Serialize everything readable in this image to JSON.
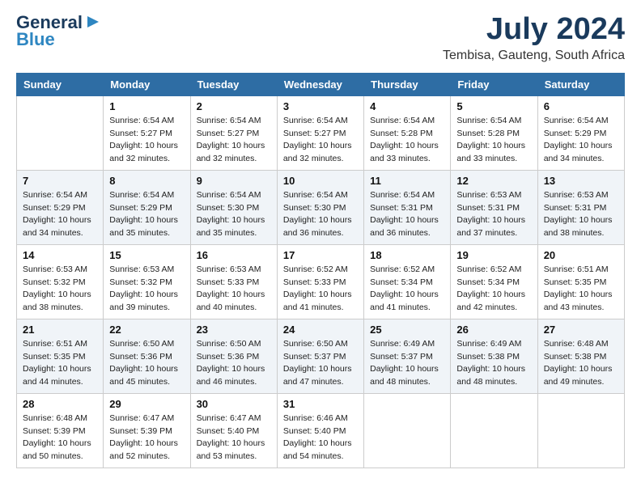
{
  "logo": {
    "line1": "General",
    "line2": "Blue"
  },
  "header": {
    "month": "July 2024",
    "location": "Tembisa, Gauteng, South Africa"
  },
  "weekdays": [
    "Sunday",
    "Monday",
    "Tuesday",
    "Wednesday",
    "Thursday",
    "Friday",
    "Saturday"
  ],
  "weeks": [
    [
      {
        "day": "",
        "info": ""
      },
      {
        "day": "1",
        "info": "Sunrise: 6:54 AM\nSunset: 5:27 PM\nDaylight: 10 hours\nand 32 minutes."
      },
      {
        "day": "2",
        "info": "Sunrise: 6:54 AM\nSunset: 5:27 PM\nDaylight: 10 hours\nand 32 minutes."
      },
      {
        "day": "3",
        "info": "Sunrise: 6:54 AM\nSunset: 5:27 PM\nDaylight: 10 hours\nand 32 minutes."
      },
      {
        "day": "4",
        "info": "Sunrise: 6:54 AM\nSunset: 5:28 PM\nDaylight: 10 hours\nand 33 minutes."
      },
      {
        "day": "5",
        "info": "Sunrise: 6:54 AM\nSunset: 5:28 PM\nDaylight: 10 hours\nand 33 minutes."
      },
      {
        "day": "6",
        "info": "Sunrise: 6:54 AM\nSunset: 5:29 PM\nDaylight: 10 hours\nand 34 minutes."
      }
    ],
    [
      {
        "day": "7",
        "info": "Sunrise: 6:54 AM\nSunset: 5:29 PM\nDaylight: 10 hours\nand 34 minutes."
      },
      {
        "day": "8",
        "info": "Sunrise: 6:54 AM\nSunset: 5:29 PM\nDaylight: 10 hours\nand 35 minutes."
      },
      {
        "day": "9",
        "info": "Sunrise: 6:54 AM\nSunset: 5:30 PM\nDaylight: 10 hours\nand 35 minutes."
      },
      {
        "day": "10",
        "info": "Sunrise: 6:54 AM\nSunset: 5:30 PM\nDaylight: 10 hours\nand 36 minutes."
      },
      {
        "day": "11",
        "info": "Sunrise: 6:54 AM\nSunset: 5:31 PM\nDaylight: 10 hours\nand 36 minutes."
      },
      {
        "day": "12",
        "info": "Sunrise: 6:53 AM\nSunset: 5:31 PM\nDaylight: 10 hours\nand 37 minutes."
      },
      {
        "day": "13",
        "info": "Sunrise: 6:53 AM\nSunset: 5:31 PM\nDaylight: 10 hours\nand 38 minutes."
      }
    ],
    [
      {
        "day": "14",
        "info": "Sunrise: 6:53 AM\nSunset: 5:32 PM\nDaylight: 10 hours\nand 38 minutes."
      },
      {
        "day": "15",
        "info": "Sunrise: 6:53 AM\nSunset: 5:32 PM\nDaylight: 10 hours\nand 39 minutes."
      },
      {
        "day": "16",
        "info": "Sunrise: 6:53 AM\nSunset: 5:33 PM\nDaylight: 10 hours\nand 40 minutes."
      },
      {
        "day": "17",
        "info": "Sunrise: 6:52 AM\nSunset: 5:33 PM\nDaylight: 10 hours\nand 41 minutes."
      },
      {
        "day": "18",
        "info": "Sunrise: 6:52 AM\nSunset: 5:34 PM\nDaylight: 10 hours\nand 41 minutes."
      },
      {
        "day": "19",
        "info": "Sunrise: 6:52 AM\nSunset: 5:34 PM\nDaylight: 10 hours\nand 42 minutes."
      },
      {
        "day": "20",
        "info": "Sunrise: 6:51 AM\nSunset: 5:35 PM\nDaylight: 10 hours\nand 43 minutes."
      }
    ],
    [
      {
        "day": "21",
        "info": "Sunrise: 6:51 AM\nSunset: 5:35 PM\nDaylight: 10 hours\nand 44 minutes."
      },
      {
        "day": "22",
        "info": "Sunrise: 6:50 AM\nSunset: 5:36 PM\nDaylight: 10 hours\nand 45 minutes."
      },
      {
        "day": "23",
        "info": "Sunrise: 6:50 AM\nSunset: 5:36 PM\nDaylight: 10 hours\nand 46 minutes."
      },
      {
        "day": "24",
        "info": "Sunrise: 6:50 AM\nSunset: 5:37 PM\nDaylight: 10 hours\nand 47 minutes."
      },
      {
        "day": "25",
        "info": "Sunrise: 6:49 AM\nSunset: 5:37 PM\nDaylight: 10 hours\nand 48 minutes."
      },
      {
        "day": "26",
        "info": "Sunrise: 6:49 AM\nSunset: 5:38 PM\nDaylight: 10 hours\nand 48 minutes."
      },
      {
        "day": "27",
        "info": "Sunrise: 6:48 AM\nSunset: 5:38 PM\nDaylight: 10 hours\nand 49 minutes."
      }
    ],
    [
      {
        "day": "28",
        "info": "Sunrise: 6:48 AM\nSunset: 5:39 PM\nDaylight: 10 hours\nand 50 minutes."
      },
      {
        "day": "29",
        "info": "Sunrise: 6:47 AM\nSunset: 5:39 PM\nDaylight: 10 hours\nand 52 minutes."
      },
      {
        "day": "30",
        "info": "Sunrise: 6:47 AM\nSunset: 5:40 PM\nDaylight: 10 hours\nand 53 minutes."
      },
      {
        "day": "31",
        "info": "Sunrise: 6:46 AM\nSunset: 5:40 PM\nDaylight: 10 hours\nand 54 minutes."
      },
      {
        "day": "",
        "info": ""
      },
      {
        "day": "",
        "info": ""
      },
      {
        "day": "",
        "info": ""
      }
    ]
  ]
}
